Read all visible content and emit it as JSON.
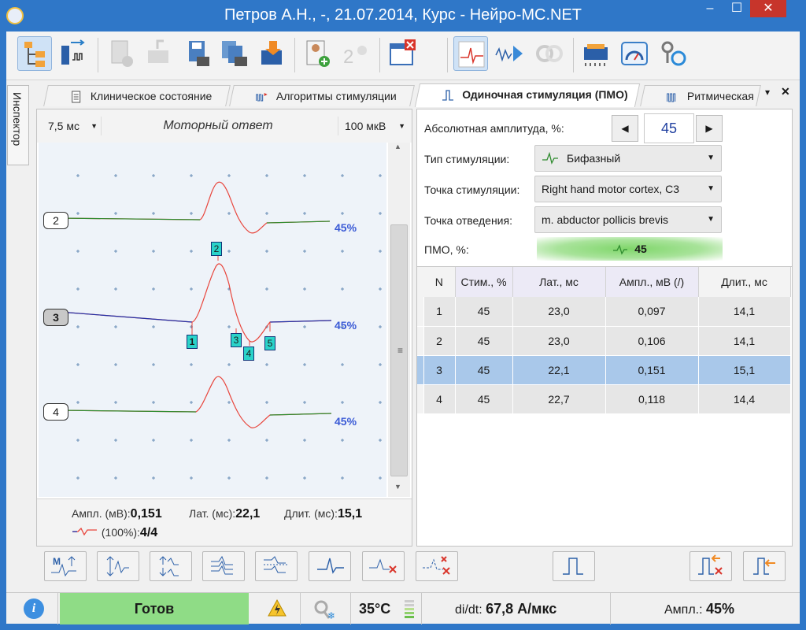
{
  "window": {
    "title": "Петров А.Н., -, 21.07.2014, Курс - Нейро-МС.NET",
    "min": "–",
    "max": "☐",
    "close": "✕"
  },
  "toolbar": {
    "icons": [
      "tree-view-icon",
      "device-sweep-icon",
      "new-document-icon",
      "export-icon",
      "save-icon",
      "save-all-icon",
      "import-box-icon",
      "add-patient-icon",
      "patients-list-icon",
      "close-window-icon",
      "waveform-view-icon",
      "play-stimulation-icon",
      "coil-icon",
      "hardware-module-icon",
      "gauge-icon",
      "settings-refresh-icon"
    ]
  },
  "inspector": {
    "label": "Инспектор"
  },
  "tabs": [
    {
      "label": "Клиническое состояние",
      "icon": "document-icon"
    },
    {
      "label": "Алгоритмы стимуляции",
      "icon": "algorithm-icon"
    },
    {
      "label": "Одиночная стимуляция (ПМО)",
      "icon": "single-pulse-icon",
      "active": true
    },
    {
      "label": "Ритмическая",
      "icon": "rhythmic-pulse-icon"
    }
  ],
  "left": {
    "time_scale": "7,5 мс",
    "title": "Моторный ответ",
    "amp_scale": "100 мкВ",
    "traces": [
      {
        "n": "2",
        "pct": "45%",
        "selected": false
      },
      {
        "n": "3",
        "pct": "45%",
        "selected": true
      },
      {
        "n": "4",
        "pct": "45%",
        "selected": false
      }
    ],
    "markers": [
      "1",
      "2",
      "3",
      "4",
      "5"
    ],
    "stats": {
      "amp_label": "Ампл. (мВ):",
      "amp_value": "0,151",
      "lat_label": "Лат. (мс):",
      "lat_value": "22,1",
      "dur_label": "Длит. (мс):",
      "dur_value": "15,1",
      "pct_label": "(100%):",
      "count_value": "4/4"
    }
  },
  "right": {
    "abs_amp_label": "Абсолютная амплитуда, %:",
    "abs_amp_value": "45",
    "stim_type_label": "Тип стимуляции:",
    "stim_type_value": "Бифазный",
    "stim_point_label": "Точка стимуляции:",
    "stim_point_value": "Right hand motor cortex, C3",
    "record_point_label": "Точка отведения:",
    "record_point_value": "m. abductor pollicis brevis",
    "pmo_label": "ПМО, %:",
    "pmo_value": "45",
    "table": {
      "headers": [
        "N",
        "Стим., %",
        "Лат., мс",
        "Ампл., мВ (/)",
        "Длит., мс"
      ],
      "rows": [
        [
          "1",
          "45",
          "23,0",
          "0,097",
          "14,1"
        ],
        [
          "2",
          "45",
          "23,0",
          "0,106",
          "14,1"
        ],
        [
          "3",
          "45",
          "22,1",
          "0,151",
          "15,1"
        ],
        [
          "4",
          "45",
          "22,7",
          "0,118",
          "14,4"
        ]
      ],
      "selected_row": 2
    }
  },
  "status": {
    "ready": "Готов",
    "temperature": "35°C",
    "didt_label": "di/dt:",
    "didt_value": "67,8 А/мкс",
    "amp_label": "Ампл.:",
    "amp_value": "45%"
  },
  "colors": {
    "accent": "#2f77c8",
    "ready": "#8fdc86",
    "trace_red": "#e8453c",
    "trace_green": "#2e8b2e",
    "trace_blue": "#1f2fa8",
    "pct_blue": "#3b5bd6",
    "marker": "#2ad3c9",
    "selected_row": "#a9c8ea"
  }
}
